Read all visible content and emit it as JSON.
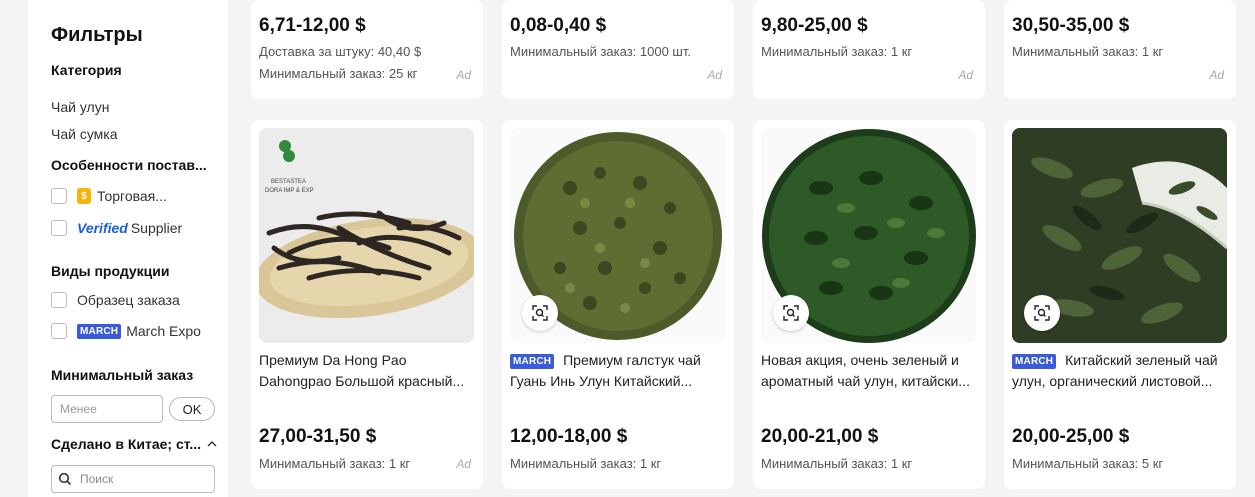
{
  "sidebar": {
    "title": "Фильтры",
    "category_heading": "Категория",
    "categories": [
      "Чай улун",
      "Чай сумка"
    ],
    "supplier_heading": "Особенности постав...",
    "trade_label": "Торговая...",
    "verified_word": "Verified",
    "verified_label": "Supplier",
    "product_heading": "Виды продукции",
    "sample_label": "Образец заказа",
    "march_badge": "MARCH",
    "march_label": "March Expo",
    "min_order_heading": "Минимальный заказ",
    "min_placeholder": "Менее",
    "ok_label": "OK",
    "made_in_heading": "Сделано в Китае; ст...",
    "search_placeholder": "Поиск"
  },
  "top_cards": [
    {
      "price": "6,71-12,00 $",
      "line1": "Доставка за штуку: 40,40 $",
      "line2": "Минимальный заказ: 25 кг",
      "ad": "Ad"
    },
    {
      "price": "0,08-0,40 $",
      "line1": "Минимальный заказ: 1000 шт.",
      "ad": "Ad"
    },
    {
      "price": "9,80-25,00 $",
      "line1": "Минимальный заказ: 1 кг",
      "ad": "Ad"
    },
    {
      "price": "30,50-35,00 $",
      "line1": "Минимальный заказ: 1 кг",
      "ad": "Ad"
    }
  ],
  "products": [
    {
      "badge": "",
      "title": "Премиум Da Hong Pao Dahongpao Большой красный...",
      "price": "27,00-31,50 $",
      "moq": "Минимальный заказ: 1 кг",
      "ad": "Ad",
      "logo_lines": [
        "BESTASTEA",
        "DORA IMP & EXP"
      ]
    },
    {
      "badge": "MARCH",
      "title": "Премиум галстук чай Гуань Инь Улун Китайский...",
      "price": "12,00-18,00 $",
      "moq": "Минимальный заказ: 1 кг"
    },
    {
      "badge": "",
      "title": "Новая акция, очень зеленый и ароматный чай улун, китайски...",
      "price": "20,00-21,00 $",
      "moq": "Минимальный заказ: 1 кг"
    },
    {
      "badge": "MARCH",
      "title": "Китайский зеленый чай улун, органический листовой...",
      "price": "20,00-25,00 $",
      "moq": "Минимальный заказ: 5 кг"
    }
  ],
  "colors": {
    "march_badge": "#3a5bd9",
    "verified": "#1a5fd6",
    "trade_badge": "#f5b40a"
  }
}
